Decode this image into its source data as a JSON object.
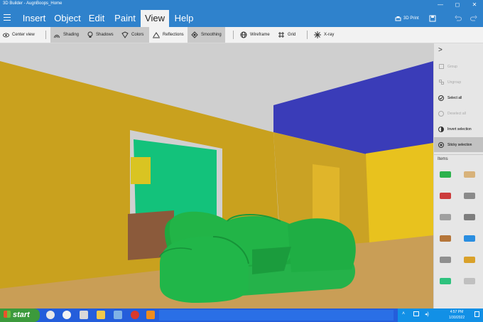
{
  "window": {
    "title": "3D Builder - AugnBoops_Home",
    "controls": {
      "minimize": "—",
      "maximize": "◻",
      "close": "✕"
    }
  },
  "menubar": {
    "tabs": [
      {
        "label": "Insert"
      },
      {
        "label": "Object"
      },
      {
        "label": "Edit"
      },
      {
        "label": "Paint"
      },
      {
        "label": "View"
      },
      {
        "label": "Help"
      }
    ],
    "active_tab": "View",
    "print_label": "3D Print"
  },
  "toolbar": {
    "items": [
      {
        "label": "Center view",
        "icon": "eye-icon",
        "active": false
      },
      {
        "label": "Shading",
        "icon": "shading-icon",
        "active": true
      },
      {
        "label": "Shadows",
        "icon": "bulb-icon",
        "active": true
      },
      {
        "label": "Colors",
        "icon": "paint-bucket-icon",
        "active": true
      },
      {
        "label": "Reflections",
        "icon": "reflection-icon",
        "active": false
      },
      {
        "label": "Smoothing",
        "icon": "smoothing-icon",
        "active": true
      },
      {
        "label": "Wireframe",
        "icon": "globe-icon",
        "active": false
      },
      {
        "label": "Grid",
        "icon": "grid-icon",
        "active": false
      },
      {
        "label": "X-ray",
        "icon": "xray-icon",
        "active": false
      }
    ]
  },
  "panel": {
    "collapse_glyph": ">",
    "actions": [
      {
        "label": "Group",
        "enabled": false
      },
      {
        "label": "Ungroup",
        "enabled": false
      },
      {
        "label": "Select all",
        "enabled": true
      },
      {
        "label": "Deselect all",
        "enabled": false
      },
      {
        "label": "Invert selection",
        "enabled": true
      },
      {
        "label": "Sticky selection",
        "enabled": true,
        "selected": true
      }
    ],
    "items_heading": "Items",
    "items": [
      {
        "name": "sofa-item",
        "color": "#2bb14c"
      },
      {
        "name": "flat-tile-item",
        "color": "#d8b27a"
      },
      {
        "name": "red-bar-item",
        "color": "#cc3b3b"
      },
      {
        "name": "gray-slab-item",
        "color": "#8a8a8a"
      },
      {
        "name": "gray-box-item",
        "color": "#a0a0a0"
      },
      {
        "name": "gray-cube-item",
        "color": "#7e7e7e"
      },
      {
        "name": "table-item",
        "color": "#b5763a"
      },
      {
        "name": "blue-bin-item",
        "color": "#2a8ee0"
      },
      {
        "name": "gray-bin-item",
        "color": "#8f8f8f"
      },
      {
        "name": "red-yellow-bar-item",
        "color": "#d9a12a"
      },
      {
        "name": "green-tray-item",
        "color": "#2ec27e"
      },
      {
        "name": "pole-item",
        "color": "#c0c0c0"
      }
    ]
  },
  "taskbar": {
    "start_label": "start",
    "clock_time": "4:57 PM",
    "clock_date": "1/30/2022"
  }
}
